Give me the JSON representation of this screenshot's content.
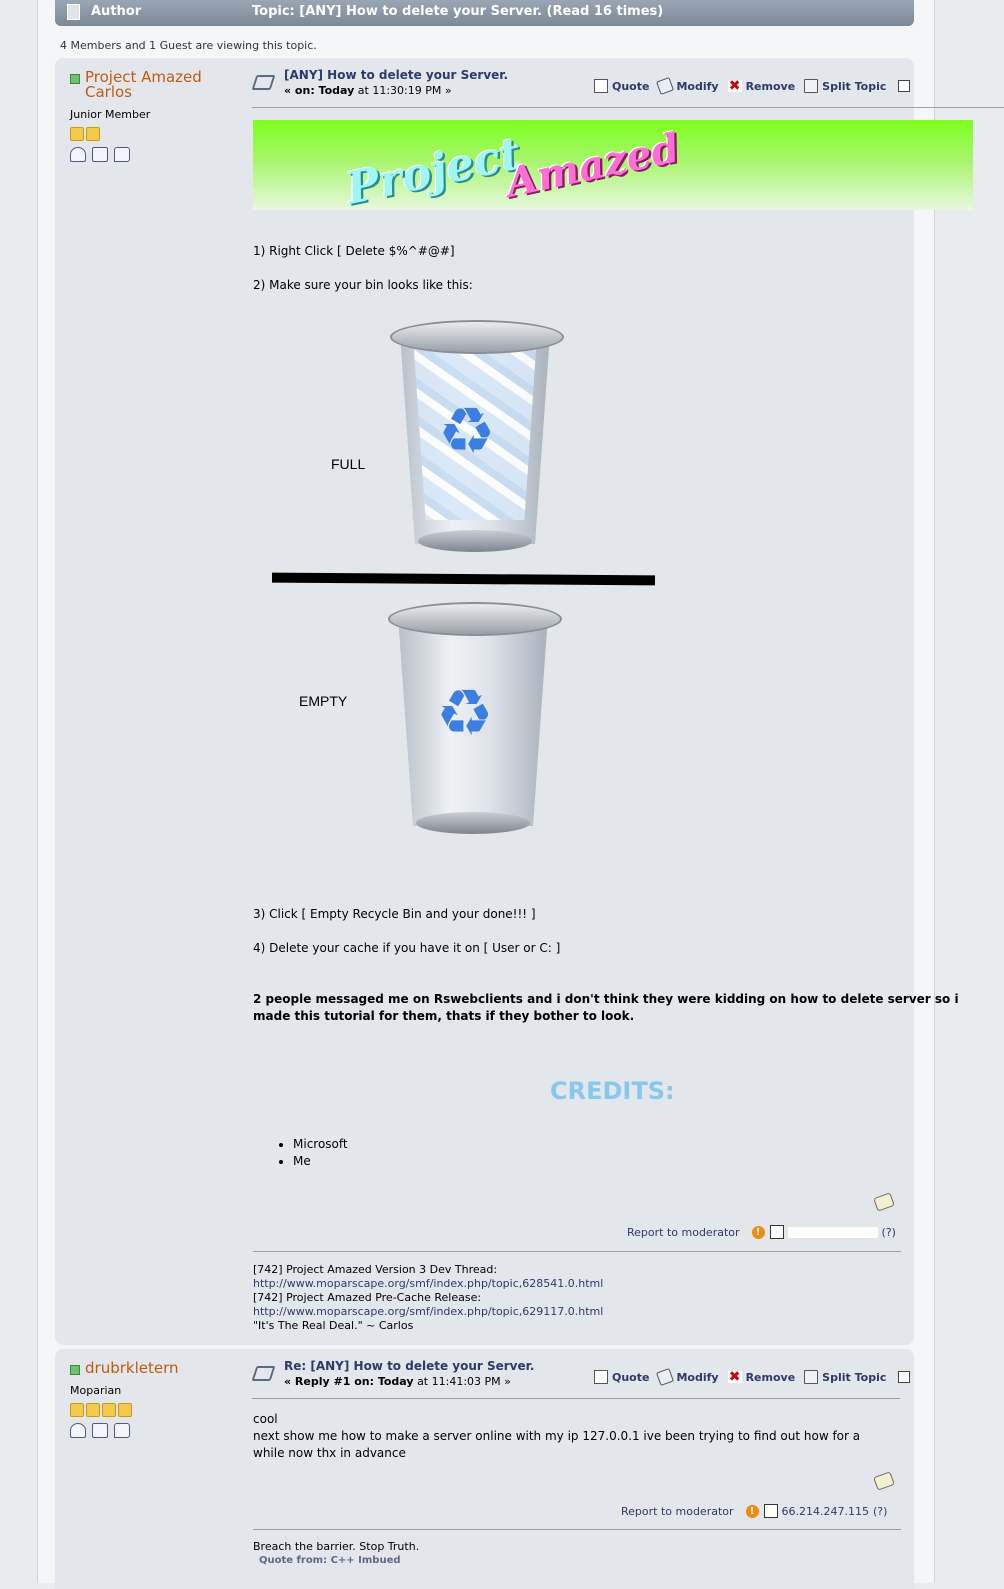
{
  "header": {
    "author_label": "Author",
    "topic_label": "Topic: [ANY] How to delete your Server.  (Read 16 times)"
  },
  "viewing": "4 Members and 1 Guest are viewing this topic.",
  "post1": {
    "poster": {
      "name_line1": "Project Amazed",
      "name_line2": "Carlos",
      "rank": "Junior Member",
      "stars": 2
    },
    "title": "[ANY] How to delete your Server.",
    "date_prefix": "« on: Today",
    "date_time": "at 11:30:19 PM »",
    "buttons": {
      "quote": "Quote",
      "modify": "Modify",
      "remove": "Remove",
      "split": "Split Topic"
    },
    "banner": {
      "word1": "Project",
      "word2": "Amazed"
    },
    "step1": "1) Right Click [ Delete $%^#@#]",
    "step2": "2) Make sure your bin looks like this:",
    "label_full": "FULL",
    "label_empty": "EMPTY",
    "step3": "3) Click [ Empty Recycle Bin and your done!!! ]",
    "step4": "4) Delete your cache if you have it on [ User or C: ]",
    "note": "2 people messaged me on Rswebclients and i don't think they were kidding on how to delete server so i made this tutorial for them, thats if they bother to look.",
    "credits_title": "CREDITS:",
    "credits": [
      "Microsoft",
      "Me"
    ],
    "report": "Report to moderator",
    "ip_help": "(?)",
    "signature": {
      "line1": "[742] Project Amazed Version 3 Dev Thread:",
      "url1": "http://www.moparscape.org/smf/index.php/topic,628541.0.html",
      "line2": "[742] Project Amazed Pre-Cache Release:",
      "url2": "http://www.moparscape.org/smf/index.php/topic,629117.0.html",
      "line3": "\"It's The Real Deal.\" ~ Carlos"
    }
  },
  "post2": {
    "poster": {
      "name": "drubrkletern",
      "rank": "Moparian",
      "stars": 4
    },
    "title": "Re: [ANY] How to delete your Server.",
    "date_prefix": "« Reply #1 on: Today",
    "date_time": "at 11:41:03 PM »",
    "buttons": {
      "quote": "Quote",
      "modify": "Modify",
      "remove": "Remove",
      "split": "Split Topic"
    },
    "body_line1": "cool",
    "body_line2": "next show me how to make a server online with my ip 127.0.0.1 ive been trying to find out how for a while now thx in advance",
    "report": "Report to moderator",
    "ip": "66.214.247.115",
    "ip_help": "(?)",
    "signature": "Breach the barrier. Stop Truth.",
    "quote_from": "Quote from: C++ Imbued"
  },
  "colors": {
    "poster_name": "#c05a10",
    "link": "#2b3b6a",
    "credits": "#87c8ec",
    "online": "#6ec36e"
  }
}
